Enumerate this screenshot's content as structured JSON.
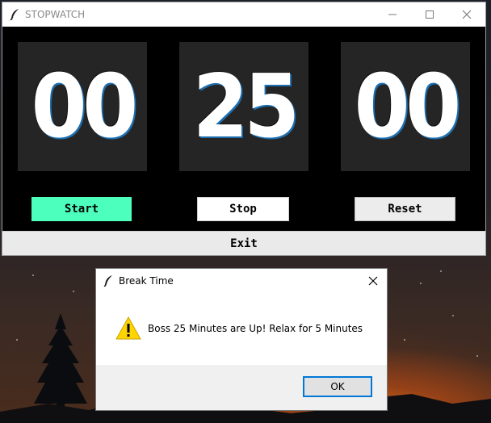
{
  "main_window": {
    "title": "STOPWATCH",
    "hours": "00",
    "minutes": "25",
    "seconds": "00",
    "start_label": "Start",
    "stop_label": "Stop",
    "reset_label": "Reset",
    "exit_label": "Exit",
    "accent_color": "#4dffbd"
  },
  "dialog": {
    "title": "Break Time",
    "message": "Boss 25 Minutes are Up! Relax for 5 Minutes",
    "ok_label": "OK",
    "icon": "warning-icon"
  },
  "icons": {
    "app_icon": "feather-icon",
    "minimize": "minimize-icon",
    "maximize": "maximize-icon",
    "close": "close-icon"
  }
}
